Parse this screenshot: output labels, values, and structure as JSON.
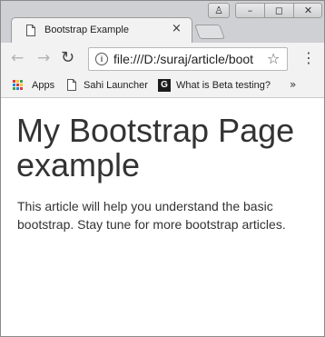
{
  "tab": {
    "title": "Bootstrap Example",
    "close": "×"
  },
  "window_controls": {
    "user": "♙",
    "minimize": "–",
    "restore": "◻",
    "close": "✕"
  },
  "toolbar": {
    "back": "←",
    "forward": "→",
    "reload": "↻",
    "menu": "⋮"
  },
  "omnibox": {
    "info": "i",
    "url": "file:///D:/suraj/article/boot",
    "star": "☆"
  },
  "bookmarks": {
    "items": [
      {
        "label": "Apps",
        "icon": "apps-grid-icon"
      },
      {
        "label": "Sahi Launcher",
        "icon": "page-icon"
      },
      {
        "label": "What is Beta testing?",
        "icon": "g-icon",
        "icon_text": "G"
      }
    ],
    "overflow": "»"
  },
  "page": {
    "heading": "My Bootstrap Page example",
    "body": "This article will help you understand the basic bootstrap. Stay tune for more bootstrap articles."
  }
}
